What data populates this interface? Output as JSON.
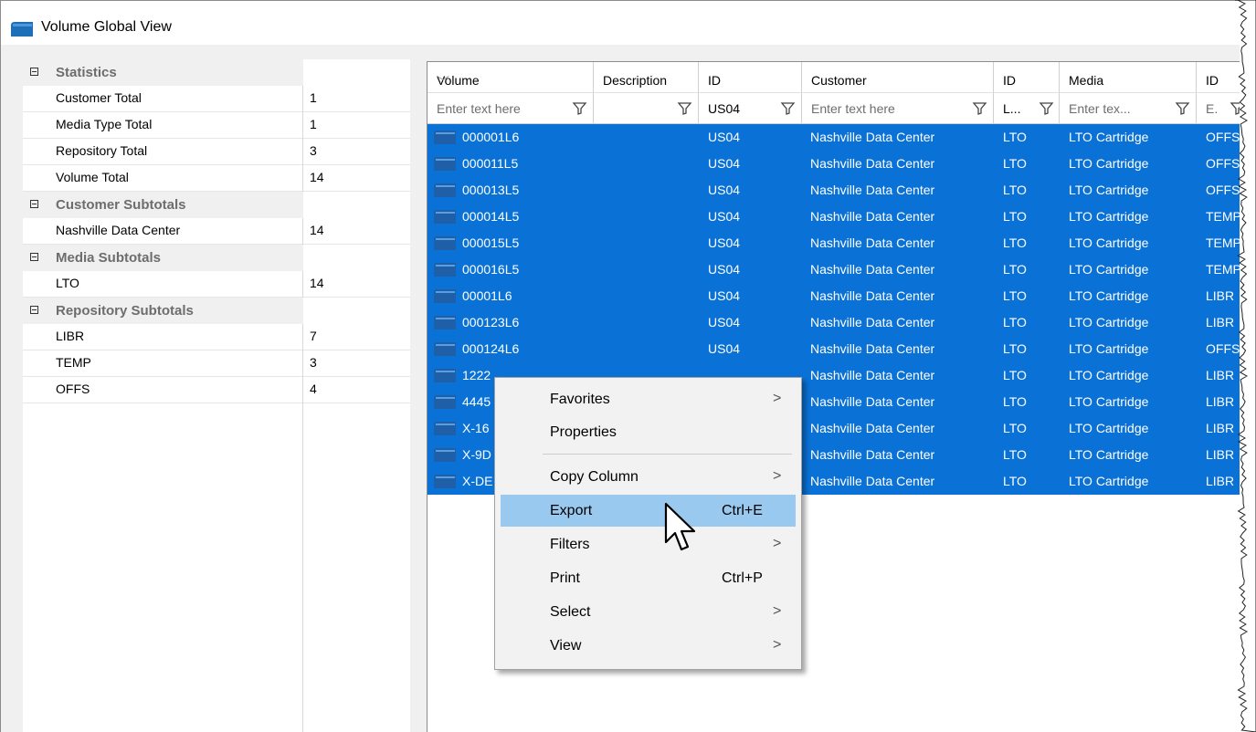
{
  "window": {
    "title": "Volume Global View"
  },
  "stats": {
    "groups": [
      {
        "label": "Statistics",
        "items": [
          {
            "label": "Customer Total",
            "value": "1"
          },
          {
            "label": "Media Type Total",
            "value": "1"
          },
          {
            "label": "Repository Total",
            "value": "3"
          },
          {
            "label": "Volume Total",
            "value": "14"
          }
        ]
      },
      {
        "label": "Customer Subtotals",
        "items": [
          {
            "label": "Nashville Data Center",
            "value": "14"
          }
        ]
      },
      {
        "label": "Media Subtotals",
        "items": [
          {
            "label": "LTO",
            "value": "14"
          }
        ]
      },
      {
        "label": "Repository Subtotals",
        "items": [
          {
            "label": "LIBR",
            "value": "7"
          },
          {
            "label": "TEMP",
            "value": "3"
          },
          {
            "label": "OFFS",
            "value": "4"
          }
        ]
      }
    ]
  },
  "grid": {
    "columns": [
      "Volume",
      "Description",
      "ID",
      "Customer",
      "ID",
      "Media",
      "ID"
    ],
    "filters": [
      "Enter text here",
      "",
      "US04",
      "Enter text here",
      "L...",
      "Enter tex...",
      "E."
    ],
    "rows": [
      {
        "volume": "000001L6",
        "id": "US04",
        "customer": "Nashville Data Center",
        "media_id": "LTO",
        "media": "LTO Cartridge",
        "repo": "OFFS"
      },
      {
        "volume": "000011L5",
        "id": "US04",
        "customer": "Nashville Data Center",
        "media_id": "LTO",
        "media": "LTO Cartridge",
        "repo": "OFFS"
      },
      {
        "volume": "000013L5",
        "id": "US04",
        "customer": "Nashville Data Center",
        "media_id": "LTO",
        "media": "LTO Cartridge",
        "repo": "OFFS"
      },
      {
        "volume": "000014L5",
        "id": "US04",
        "customer": "Nashville Data Center",
        "media_id": "LTO",
        "media": "LTO Cartridge",
        "repo": "TEMP"
      },
      {
        "volume": "000015L5",
        "id": "US04",
        "customer": "Nashville Data Center",
        "media_id": "LTO",
        "media": "LTO Cartridge",
        "repo": "TEMP"
      },
      {
        "volume": "000016L5",
        "id": "US04",
        "customer": "Nashville Data Center",
        "media_id": "LTO",
        "media": "LTO Cartridge",
        "repo": "TEMP"
      },
      {
        "volume": "00001L6",
        "id": "US04",
        "customer": "Nashville Data Center",
        "media_id": "LTO",
        "media": "LTO Cartridge",
        "repo": "LIBR"
      },
      {
        "volume": "000123L6",
        "id": "US04",
        "customer": "Nashville Data Center",
        "media_id": "LTO",
        "media": "LTO Cartridge",
        "repo": "LIBR"
      },
      {
        "volume": "000124L6",
        "id": "US04",
        "customer": "Nashville Data Center",
        "media_id": "LTO",
        "media": "LTO Cartridge",
        "repo": "OFFS"
      },
      {
        "volume": "1222",
        "id": "",
        "customer": "Nashville Data Center",
        "media_id": "LTO",
        "media": "LTO Cartridge",
        "repo": "LIBR"
      },
      {
        "volume": "4445",
        "id": "",
        "customer": "Nashville Data Center",
        "media_id": "LTO",
        "media": "LTO Cartridge",
        "repo": "LIBR"
      },
      {
        "volume": "X-16",
        "id": "",
        "customer": "Nashville Data Center",
        "media_id": "LTO",
        "media": "LTO Cartridge",
        "repo": "LIBR"
      },
      {
        "volume": "X-9D",
        "id": "",
        "customer": "Nashville Data Center",
        "media_id": "LTO",
        "media": "LTO Cartridge",
        "repo": "LIBR"
      },
      {
        "volume": "X-DE",
        "id": "",
        "customer": "Nashville Data Center",
        "media_id": "LTO",
        "media": "LTO Cartridge",
        "repo": "LIBR"
      }
    ]
  },
  "context_menu": {
    "items": [
      {
        "label": "Favorites",
        "shortcut": "",
        "submenu": true
      },
      {
        "label": "Properties",
        "shortcut": "",
        "submenu": false
      },
      {
        "label": "Copy Column",
        "shortcut": "",
        "submenu": true
      },
      {
        "label": "Export",
        "shortcut": "Ctrl+E",
        "submenu": false,
        "highlighted": true
      },
      {
        "label": "Filters",
        "shortcut": "",
        "submenu": true
      },
      {
        "label": "Print",
        "shortcut": "Ctrl+P",
        "submenu": false
      },
      {
        "label": "Select",
        "shortcut": "",
        "submenu": true
      },
      {
        "label": "View",
        "shortcut": "",
        "submenu": true
      }
    ],
    "arrow_glyph": ">"
  },
  "colors": {
    "selection": "#0a72d6",
    "menu_highlight": "#99c9ef",
    "app_icon": "#1f6fb8"
  }
}
